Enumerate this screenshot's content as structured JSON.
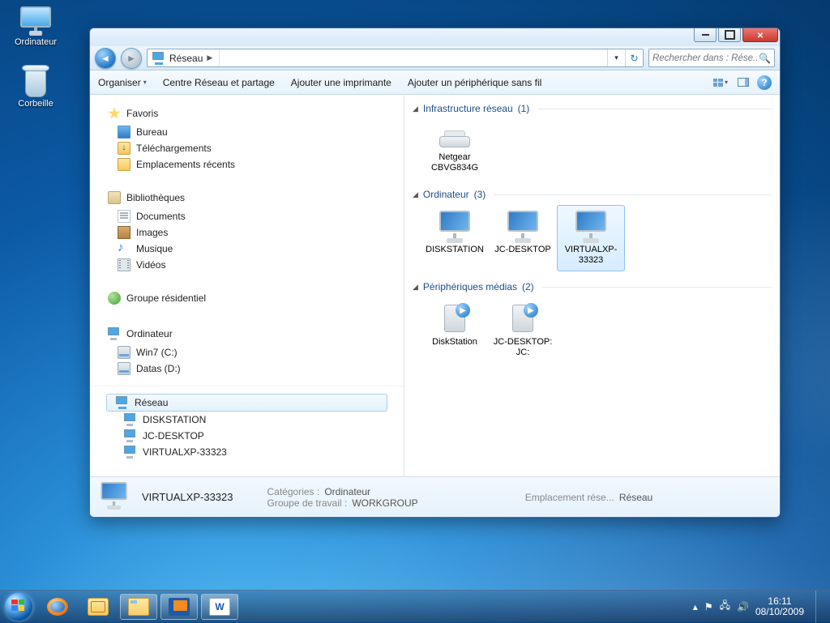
{
  "desktop": {
    "computer": "Ordinateur",
    "recycle": "Corbeille"
  },
  "window": {
    "controls": {
      "min": "Minimize",
      "max": "Maximize",
      "close": "Close"
    }
  },
  "address": {
    "root_label": "Réseau",
    "refresh_tip": "Actualiser"
  },
  "search": {
    "placeholder": "Rechercher dans : Rése..."
  },
  "toolbar": {
    "organize": "Organiser",
    "network_center": "Centre Réseau et partage",
    "add_printer": "Ajouter une imprimante",
    "add_wifi": "Ajouter un périphérique sans fil"
  },
  "nav": {
    "favorites": {
      "label": "Favoris",
      "items": [
        {
          "icon": "nic-desk",
          "label": "Bureau"
        },
        {
          "icon": "nic-dl",
          "label": "Téléchargements"
        },
        {
          "icon": "nic-recent",
          "label": "Emplacements récents"
        }
      ]
    },
    "libraries": {
      "label": "Bibliothèques",
      "items": [
        {
          "icon": "nic-doc",
          "label": "Documents"
        },
        {
          "icon": "nic-img",
          "label": "Images"
        },
        {
          "icon": "nic-mus",
          "label": "Musique"
        },
        {
          "icon": "nic-vid",
          "label": "Vidéos"
        }
      ]
    },
    "homegroup": {
      "label": "Groupe résidentiel"
    },
    "computer": {
      "label": "Ordinateur",
      "items": [
        {
          "icon": "nic-drv",
          "label": "Win7 (C:)"
        },
        {
          "icon": "nic-drv",
          "label": "Datas (D:)"
        }
      ]
    },
    "network": {
      "label": "Réseau",
      "items": [
        {
          "icon": "nic-pc",
          "label": "DISKSTATION"
        },
        {
          "icon": "nic-pc",
          "label": "JC-DESKTOP"
        },
        {
          "icon": "nic-pc",
          "label": "VIRTUALXP-33323"
        }
      ]
    }
  },
  "content": {
    "infra": {
      "label": "Infrastructure réseau",
      "count": "(1)",
      "items": [
        {
          "type": "router",
          "label": "Netgear CBVG834G"
        }
      ]
    },
    "computers": {
      "label": "Ordinateur",
      "count": "(3)",
      "items": [
        {
          "type": "pc",
          "label": "DISKSTATION"
        },
        {
          "type": "pc",
          "label": "JC-DESKTOP"
        },
        {
          "type": "pc",
          "label": "VIRTUALXP-33323",
          "selected": true
        }
      ]
    },
    "media": {
      "label": "Périphériques médias",
      "count": "(2)",
      "items": [
        {
          "type": "media",
          "label": "DiskStation"
        },
        {
          "type": "media",
          "label": "JC-DESKTOP: JC:"
        }
      ]
    }
  },
  "details": {
    "name": "VIRTUALXP-33323",
    "cat_label": "Catégories :",
    "cat_value": "Ordinateur",
    "wg_label": "Groupe de travail :",
    "wg_value": "WORKGROUP",
    "loc_label": "Emplacement rése...",
    "loc_value": "Réseau"
  },
  "tray": {
    "time": "16:11",
    "date": "08/10/2009"
  }
}
